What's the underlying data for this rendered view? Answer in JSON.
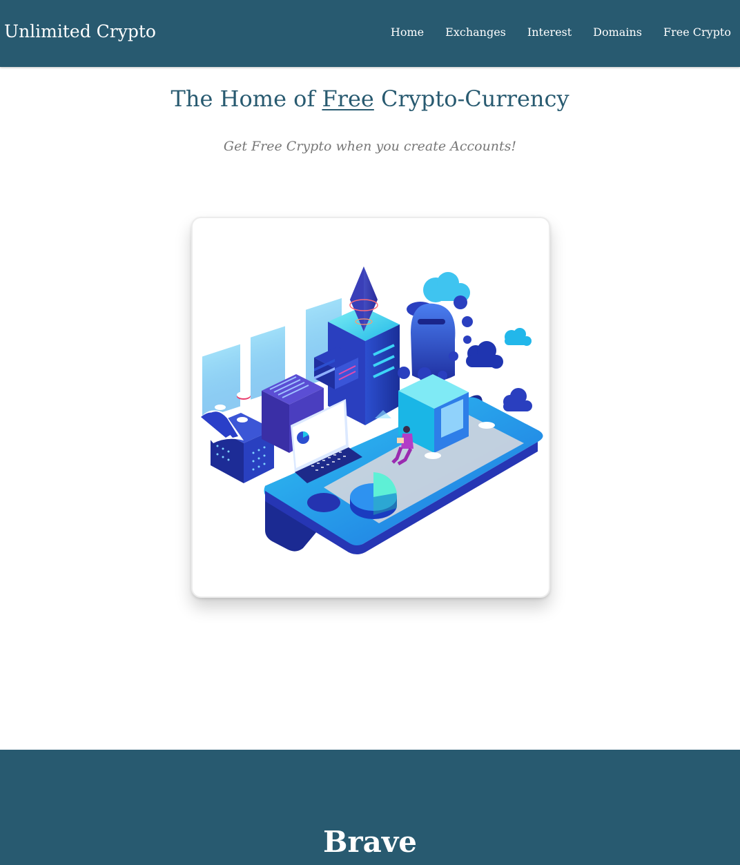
{
  "navbar": {
    "brand": "Unlimited Crypto",
    "links": [
      "Home",
      "Exchanges",
      "Interest",
      "Domains",
      "Free Crypto"
    ]
  },
  "hero": {
    "title_before": "The Home of ",
    "title_emphasis": "Free",
    "title_after": " Crypto-Currency",
    "subtitle": "Get Free Crypto when you create Accounts!"
  },
  "illustration": {
    "icon": "crypto-isometric-city-illustration"
  },
  "section": {
    "title": "Brave"
  },
  "colors": {
    "primary": "#285a70",
    "subtitle": "#777777",
    "accent_blue": "#1e88e5",
    "accent_cyan": "#26c6da",
    "accent_indigo": "#3949ab"
  }
}
